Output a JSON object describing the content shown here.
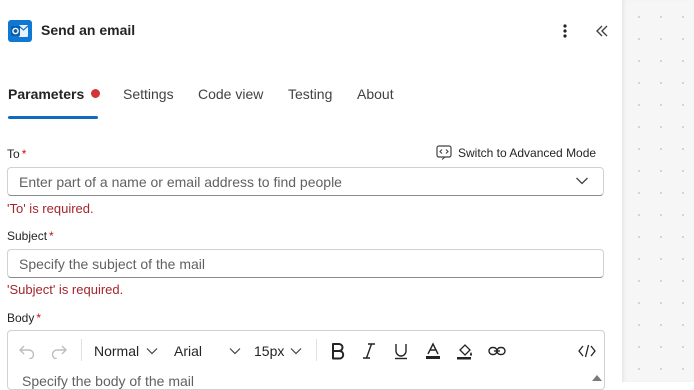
{
  "header": {
    "title": "Send an email",
    "app_icon": "outlook-icon",
    "more_icon": "more-vertical-icon",
    "collapse_icon": "chevron-double-left-icon"
  },
  "tabs": [
    {
      "label": "Parameters",
      "active": true,
      "has_error": true
    },
    {
      "label": "Settings",
      "active": false
    },
    {
      "label": "Code view",
      "active": false
    },
    {
      "label": "Testing",
      "active": false
    },
    {
      "label": "About",
      "active": false
    }
  ],
  "advanced_mode": {
    "label": "Switch to Advanced Mode",
    "icon": "code-switch-icon"
  },
  "to": {
    "label": "To",
    "required_mark": "*",
    "placeholder": "Enter part of a name or email address to find people",
    "error": "'To' is required."
  },
  "subject": {
    "label": "Subject",
    "required_mark": "*",
    "placeholder": "Specify the subject of the mail",
    "error": "'Subject' is required."
  },
  "body": {
    "label": "Body",
    "required_mark": "*",
    "placeholder": "Specify the body of the mail",
    "toolbar": {
      "block_format": "Normal",
      "font_family": "Arial",
      "font_size": "15px"
    }
  },
  "colors": {
    "accent": "#0f6cbd",
    "error": "#a4262c",
    "error_dot": "#d13438",
    "outlook_blue": "#0f78d4"
  }
}
